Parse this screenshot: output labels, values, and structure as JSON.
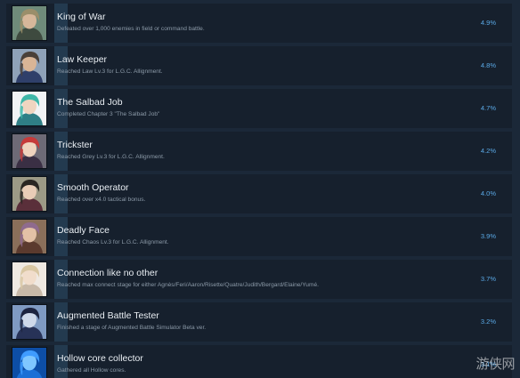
{
  "achievements": [
    {
      "name": "King of War",
      "description": "Defeated over 1,000 enemies in field or command battle.",
      "percent": "4.9%",
      "unlock_fraction": 0.049,
      "avatar_icon": "soldier-portrait-icon",
      "colors": {
        "bg": "#6f8b7a",
        "hair": "#9a8e6a",
        "skin": "#d7b79a",
        "outfit": "#3e4a3f"
      }
    },
    {
      "name": "Law Keeper",
      "description": "Reached Law Lv.3 for L.G.C. Allignment.",
      "percent": "4.8%",
      "unlock_fraction": 0.048,
      "avatar_icon": "law-keeper-portrait-icon",
      "colors": {
        "bg": "#8fa2b8",
        "hair": "#4a4038",
        "skin": "#d9b596",
        "outfit": "#2f3f6a"
      }
    },
    {
      "name": "The Salbad Job",
      "description": "Completed Chapter 3 \"The Salbad Job\"",
      "percent": "4.7%",
      "unlock_fraction": 0.047,
      "avatar_icon": "teal-haired-portrait-icon",
      "colors": {
        "bg": "#f1f3f5",
        "hair": "#3fb7a8",
        "skin": "#f0d5c0",
        "outfit": "#2f7f86"
      }
    },
    {
      "name": "Trickster",
      "description": "Reached Grey Lv.3 for L.G.C. Allignment.",
      "percent": "4.2%",
      "unlock_fraction": 0.042,
      "avatar_icon": "red-haired-portrait-icon",
      "colors": {
        "bg": "#6d6a76",
        "hair": "#c63a3a",
        "skin": "#efd3be",
        "outfit": "#3a2f44"
      }
    },
    {
      "name": "Smooth Operator",
      "description": "Reached over x4.0 tactical bonus.",
      "percent": "4.0%",
      "unlock_fraction": 0.04,
      "avatar_icon": "dark-haired-portrait-icon",
      "colors": {
        "bg": "#9c9a86",
        "hair": "#2a2622",
        "skin": "#e9cdb7",
        "outfit": "#5a2f3a"
      }
    },
    {
      "name": "Deadly Face",
      "description": "Reached Chaos Lv.3 for L.G.C. Allignment.",
      "percent": "3.9%",
      "unlock_fraction": 0.039,
      "avatar_icon": "chaos-portrait-icon",
      "colors": {
        "bg": "#8a6f5a",
        "hair": "#8f6b8e",
        "skin": "#e3c1a6",
        "outfit": "#5b3a2e"
      }
    },
    {
      "name": "Connection like no other",
      "description": "Reached max connect stage for either Agnès/Feri/Aaron/Risette/Quatre/Judith/Bergard/Elaine/Yumé.",
      "percent": "3.7%",
      "unlock_fraction": 0.037,
      "avatar_icon": "blonde-portrait-icon",
      "colors": {
        "bg": "#efe9e2",
        "hair": "#d9c7a3",
        "skin": "#f1ddcb",
        "outfit": "#c8b9a8"
      }
    },
    {
      "name": "Augmented Battle Tester",
      "description": "Finished a stage of Augmented Battle Simulator Beta ver.",
      "percent": "3.2%",
      "unlock_fraction": 0.032,
      "avatar_icon": "armored-portrait-icon",
      "colors": {
        "bg": "#7f9ac2",
        "hair": "#1d2440",
        "skin": "#cfd9ea",
        "outfit": "#273257"
      }
    },
    {
      "name": "Hollow core collector",
      "description": "Gathered all Hollow cores.",
      "percent": "3.1%",
      "unlock_fraction": 0.031,
      "avatar_icon": "hollow-core-portrait-icon",
      "colors": {
        "bg": "#0d4ea6",
        "hair": "#3f9cff",
        "skin": "#7fc7ff",
        "outfit": "#1b6fd6"
      }
    }
  ],
  "watermark": "游侠网"
}
